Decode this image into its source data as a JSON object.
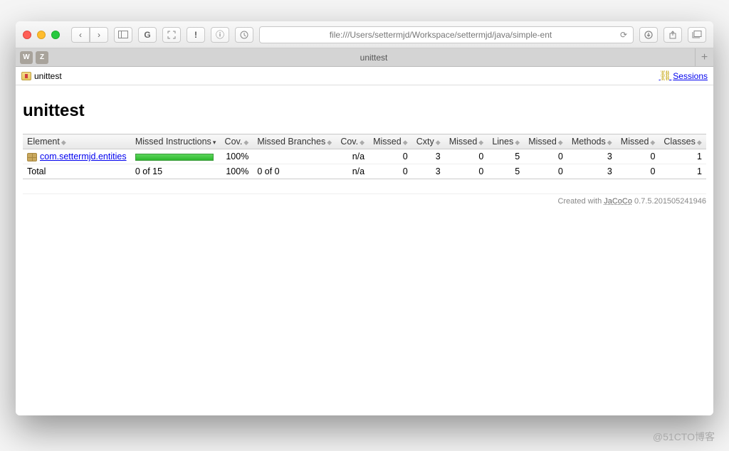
{
  "browser": {
    "url": "file:///Users/settermjd/Workspace/settermjd/java/simple-ent",
    "tab_title": "unittest",
    "tab_buttons": [
      "W",
      "Z"
    ]
  },
  "breadcrumb": {
    "current": "unittest",
    "sessions_label": "Sessions"
  },
  "page": {
    "title": "unittest"
  },
  "table": {
    "headers": {
      "element": "Element",
      "missed_instr": "Missed Instructions",
      "cov1": "Cov.",
      "missed_branches": "Missed Branches",
      "cov2": "Cov.",
      "missed1": "Missed",
      "cxty": "Cxty",
      "missed2": "Missed",
      "lines": "Lines",
      "missed3": "Missed",
      "methods": "Methods",
      "missed4": "Missed",
      "classes": "Classes"
    },
    "rows": [
      {
        "element": "com.settermjd.entities",
        "is_link": true,
        "has_bar": true,
        "cov1": "100%",
        "missed_branches": "",
        "cov2": "n/a",
        "missed1": "0",
        "cxty": "3",
        "missed2": "0",
        "lines": "5",
        "missed3": "0",
        "methods": "3",
        "missed4": "0",
        "classes": "1"
      },
      {
        "element": "Total",
        "is_link": false,
        "missed_instr_text": "0 of 15",
        "cov1": "100%",
        "missed_branches": "0 of 0",
        "cov2": "n/a",
        "missed1": "0",
        "cxty": "3",
        "missed2": "0",
        "lines": "5",
        "missed3": "0",
        "methods": "3",
        "missed4": "0",
        "classes": "1"
      }
    ]
  },
  "footer": {
    "prefix": "Created with ",
    "tool": "JaCoCo",
    "version": " 0.7.5.201505241946"
  },
  "watermark": "@51CTO博客"
}
